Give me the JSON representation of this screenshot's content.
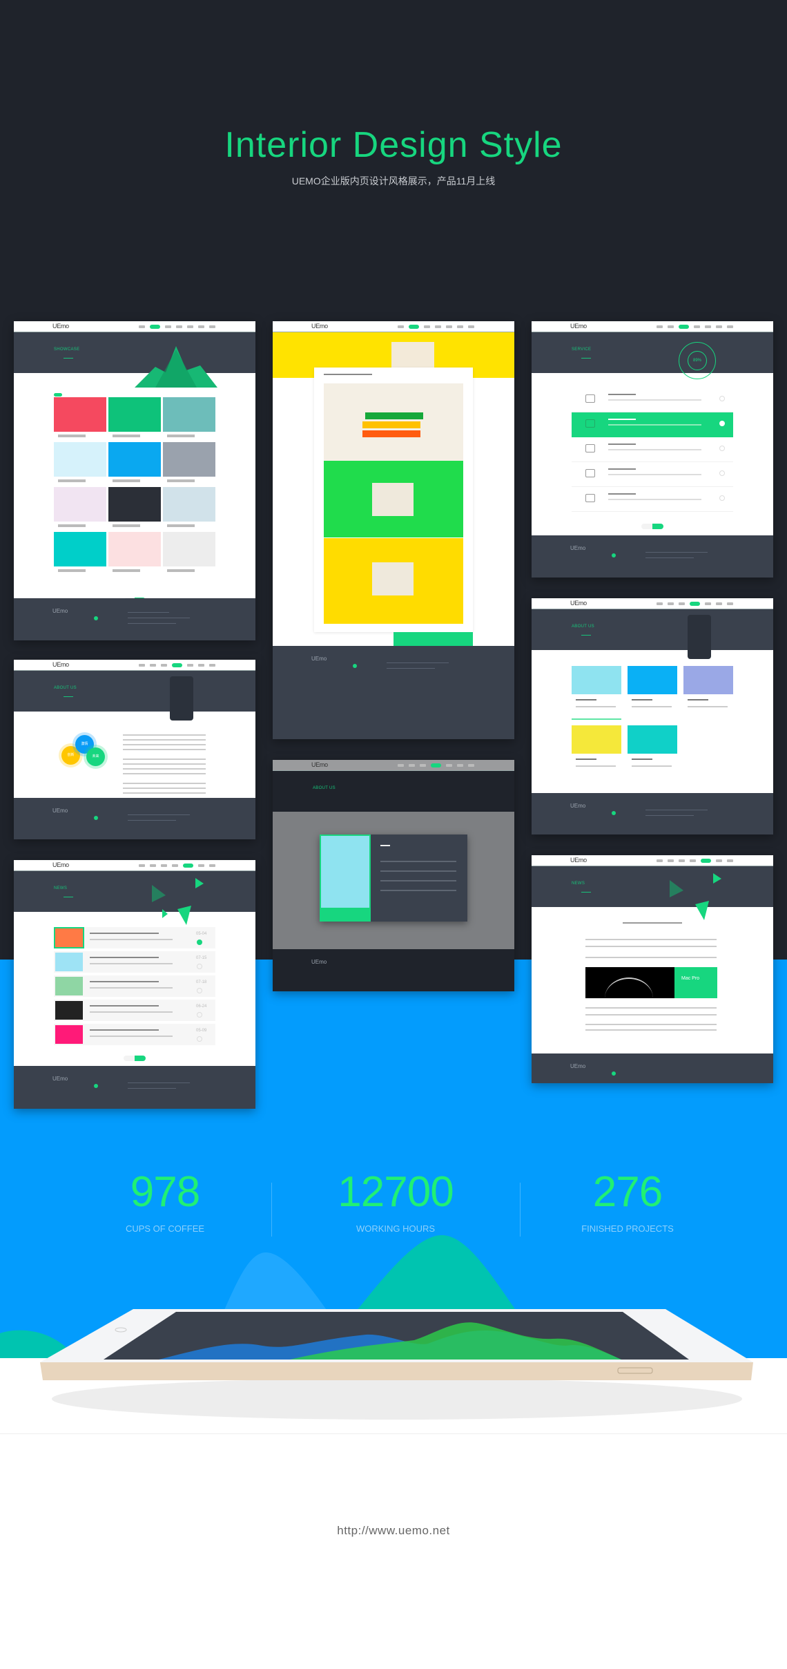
{
  "header": {
    "title": "Interior Design Style",
    "subtitle": "UEMO企业版内页设计风格展示，产品11月上线"
  },
  "mockups": {
    "logo": "UEmo",
    "showcase": {
      "banner": "SHOWCASE",
      "tile_colors": [
        "#f5495f",
        "#0ec27a",
        "#6dbdba",
        "#d6f2fb",
        "#0aa8f0",
        "#9aa2ad",
        "#f1e4f2",
        "#2b2f37",
        "#d1e2ea",
        "#00cfc9",
        "#fce0e1",
        "#ededed"
      ]
    },
    "about": {
      "banner": "ABOUT US",
      "circles": [
        "激情",
        "创新",
        "未来"
      ]
    },
    "news": {
      "banner": "NEWS",
      "dates": [
        "05-04",
        "07-15",
        "07-18",
        "06-24",
        "05-09"
      ]
    },
    "service": {
      "banner": "SERVICE",
      "ring_value": "89%"
    },
    "team": {
      "banner": "ABOUT US"
    },
    "article": {
      "banner": "NEWS",
      "promo_title": "Mac Pro"
    },
    "modal": {
      "banner": "ABOUT US"
    }
  },
  "stats": [
    {
      "value": "978",
      "label": "CUPS OF COFFEE"
    },
    {
      "value": "12700",
      "label": "WORKING HOURS"
    },
    {
      "value": "276",
      "label": "FINISHED PROJECTS"
    }
  ],
  "footer": {
    "url": "http://www.uemo.net"
  },
  "colors": {
    "accent": "#17d67f",
    "dark": "#1f232b",
    "blue": "#039cfd",
    "panel": "#3a414d"
  }
}
